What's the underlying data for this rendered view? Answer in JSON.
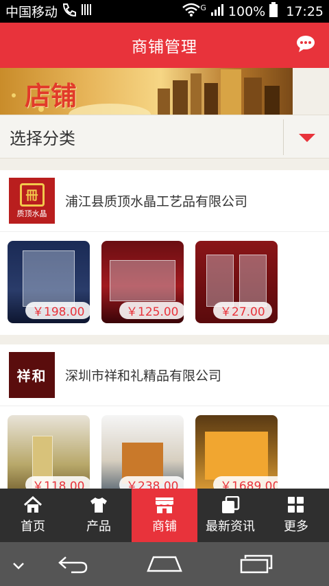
{
  "status": {
    "carrier": "中国移动",
    "battery": "100%",
    "time": "17:25",
    "network": "G"
  },
  "header": {
    "title": "商铺管理",
    "chat_icon": "chat-bubble-icon"
  },
  "banner": {
    "text": "店铺"
  },
  "category": {
    "label": "选择分类"
  },
  "shops": [
    {
      "name": "浦江县质顶水晶工艺品有限公司",
      "logo_text": "质顶水晶",
      "products": [
        {
          "price": "￥198.00"
        },
        {
          "price": "￥125.00"
        },
        {
          "price": "￥27.00"
        }
      ]
    },
    {
      "name": "深圳市祥和礼精品有限公司",
      "logo_text": "祥和",
      "products": [
        {
          "price": "￥118.00"
        },
        {
          "price": "￥238.00"
        },
        {
          "price": "￥1689.00"
        }
      ]
    }
  ],
  "tabs": [
    {
      "label": "首页",
      "icon": "home-icon"
    },
    {
      "label": "产品",
      "icon": "shirt-icon"
    },
    {
      "label": "商铺",
      "icon": "store-icon"
    },
    {
      "label": "最新资讯",
      "icon": "news-icon"
    },
    {
      "label": "更多",
      "icon": "grid-icon"
    }
  ],
  "colors": {
    "accent": "#e8333b",
    "tabbar": "#2f2f2f",
    "navbar": "#555555"
  }
}
